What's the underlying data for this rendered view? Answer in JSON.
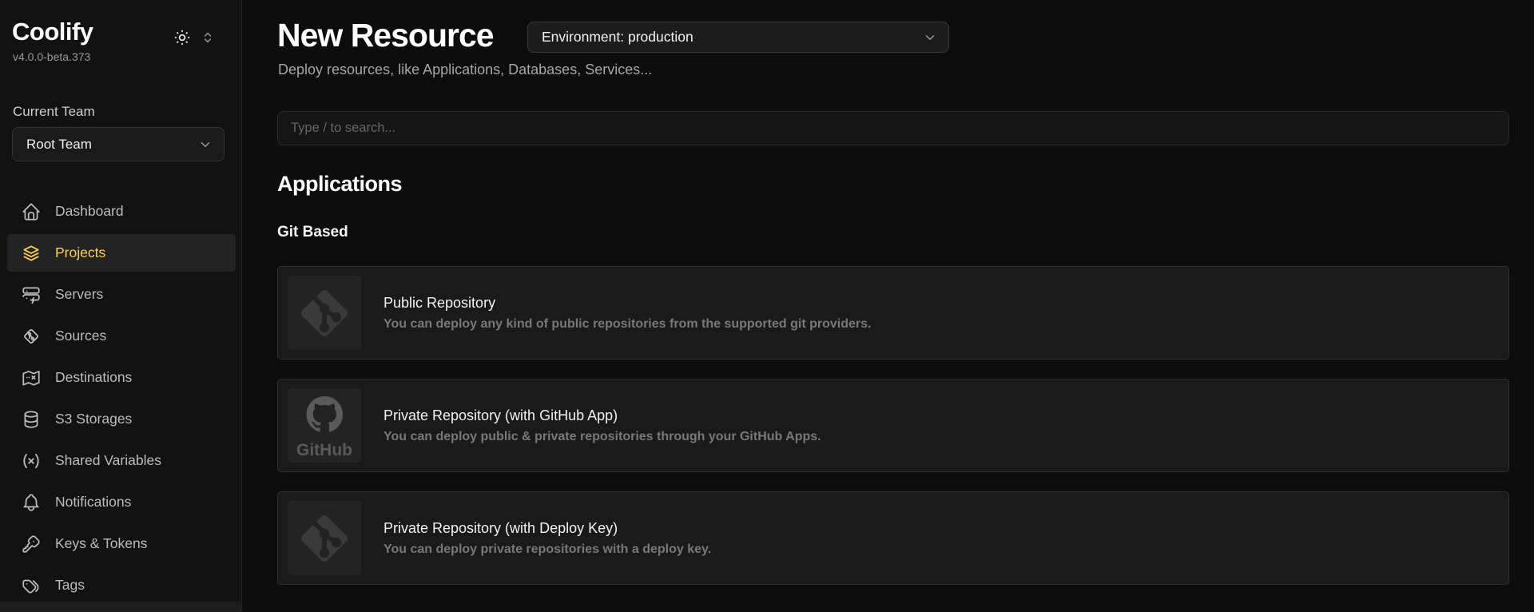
{
  "sidebar": {
    "logo": "Coolify",
    "version": "v4.0.0-beta.373",
    "theme_toggle_icon": "sun-icon",
    "team_switcher_icon": "selector-icon",
    "current_team_label": "Current Team",
    "team_select": {
      "value": "Root Team"
    },
    "items": [
      {
        "id": "dashboard",
        "label": "Dashboard",
        "icon": "home-icon",
        "active": false
      },
      {
        "id": "projects",
        "label": "Projects",
        "icon": "layers-icon",
        "active": true
      },
      {
        "id": "servers",
        "label": "Servers",
        "icon": "server-icon",
        "active": false
      },
      {
        "id": "sources",
        "label": "Sources",
        "icon": "git-source-icon",
        "active": false
      },
      {
        "id": "destinations",
        "label": "Destinations",
        "icon": "map-icon",
        "active": false
      },
      {
        "id": "s3-storages",
        "label": "S3 Storages",
        "icon": "database-icon",
        "active": false
      },
      {
        "id": "shared-variables",
        "label": "Shared Variables",
        "icon": "variables-icon",
        "active": false
      },
      {
        "id": "notifications",
        "label": "Notifications",
        "icon": "bell-icon",
        "active": false
      },
      {
        "id": "keys-tokens",
        "label": "Keys & Tokens",
        "icon": "key-icon",
        "active": false
      },
      {
        "id": "tags",
        "label": "Tags",
        "icon": "tags-icon",
        "active": false
      }
    ]
  },
  "main": {
    "title": "New Resource",
    "environment_select": {
      "value": "Environment: production"
    },
    "subtitle": "Deploy resources, like Applications, Databases, Services...",
    "search": {
      "placeholder": "Type / to search..."
    },
    "section_title": "Applications",
    "subsection_title": "Git Based",
    "cards": [
      {
        "id": "public-repository",
        "title": "Public Repository",
        "description": "You can deploy any kind of public repositories from the supported git providers.",
        "icon": "git-icon"
      },
      {
        "id": "private-repository-github-app",
        "title": "Private Repository (with GitHub App)",
        "description": "You can deploy public & private repositories through your GitHub Apps.",
        "icon": "github-icon"
      },
      {
        "id": "private-repository-deploy-key",
        "title": "Private Repository (with Deploy Key)",
        "description": "You can deploy private repositories with a deploy key.",
        "icon": "git-icon"
      }
    ]
  },
  "colors": {
    "accent_yellow": "#fcd34d",
    "page_bg": "#0d0d0d",
    "sidebar_bg": "#121212",
    "card_bg": "#1a1a1a",
    "card_border": "#2f2f2f"
  }
}
